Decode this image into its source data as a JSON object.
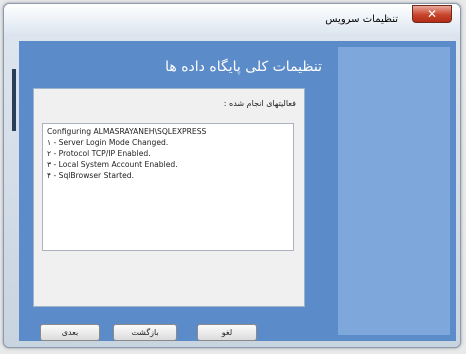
{
  "window": {
    "title": "تنظیمات سرویس",
    "close_glyph": "✕"
  },
  "main": {
    "heading": "تنظیمات کلی پایگاه داده ها",
    "status_label": "فعالیتهای انجام شده :",
    "log_lines": [
      "Configuring ALMASRAYANEH\\SQLEXPRESS",
      "۱ - Server Login Mode Changed.",
      "۲ - Protocol TCP/IP Enabled.",
      "۳ - Local System Account Enabled.",
      "۴ - SqlBrowser Started."
    ]
  },
  "buttons": {
    "next_label": "بعدی",
    "back_label": "بازگشت",
    "cancel_label": "لغو"
  }
}
